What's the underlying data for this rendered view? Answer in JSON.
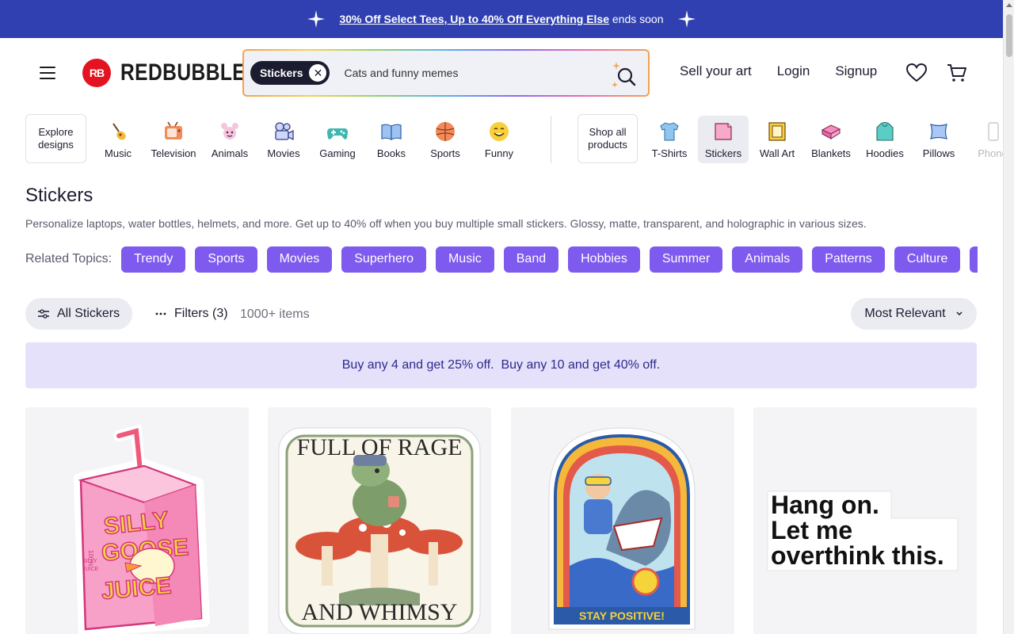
{
  "promo": {
    "link_text": "30% Off Select Tees, Up to 40% Off Everything Else",
    "suffix": "ends soon"
  },
  "header": {
    "logo_mark": "RB",
    "logo_text": "REDBUBBLE",
    "search": {
      "chip_label": "Stickers",
      "placeholder": "Cats and funny memes"
    },
    "links": [
      "Sell your art",
      "Login",
      "Signup"
    ]
  },
  "category_bar": {
    "explore": "Explore designs",
    "design_categories": [
      {
        "label": "Music",
        "icon": "guitar-icon"
      },
      {
        "label": "Television",
        "icon": "tv-icon"
      },
      {
        "label": "Animals",
        "icon": "animal-icon"
      },
      {
        "label": "Movies",
        "icon": "movie-camera-icon"
      },
      {
        "label": "Gaming",
        "icon": "gamepad-icon"
      },
      {
        "label": "Books",
        "icon": "book-icon"
      },
      {
        "label": "Sports",
        "icon": "ball-icon"
      },
      {
        "label": "Funny",
        "icon": "smile-icon"
      }
    ],
    "shop_all": "Shop all products",
    "product_categories": [
      {
        "label": "T-Shirts",
        "icon": "tshirt-icon"
      },
      {
        "label": "Stickers",
        "icon": "sticker-icon",
        "active": true
      },
      {
        "label": "Wall Art",
        "icon": "frame-icon"
      },
      {
        "label": "Blankets",
        "icon": "blanket-icon"
      },
      {
        "label": "Hoodies",
        "icon": "hoodie-icon"
      },
      {
        "label": "Pillows",
        "icon": "pillow-icon"
      },
      {
        "label": "Phone",
        "icon": "phone-icon"
      }
    ]
  },
  "page": {
    "title": "Stickers",
    "description": "Personalize laptops, water bottles, helmets, and more. Get up to 40% off when you buy multiple small stickers. Glossy, matte, transparent, and holographic in various sizes."
  },
  "related": {
    "label": "Related Topics:",
    "topics": [
      "Trendy",
      "Sports",
      "Movies",
      "Superhero",
      "Music",
      "Band",
      "Hobbies",
      "Summer",
      "Animals",
      "Patterns",
      "Culture",
      ""
    ]
  },
  "filters": {
    "all_label": "All Stickers",
    "filters_label": "Filters (3)",
    "count": "1000+ items",
    "sort_label": "Most Relevant"
  },
  "banner": {
    "text": "Buy any 4 and get 25% off.  Buy any 10 and get 40% off."
  },
  "products": [
    {
      "art_text": [
        "SILLY",
        "GOOSE",
        "JUICE",
        "100%",
        "SILLY",
        "JUICE"
      ]
    },
    {
      "art_text": [
        "FULL OF RAGE",
        "AND WHIMSY"
      ]
    },
    {
      "art_text": [
        "STAY POSITIVE!"
      ]
    },
    {
      "art_text": [
        "Hang on.",
        "Let me",
        "overthink this."
      ]
    }
  ],
  "colors": {
    "promo_bg": "#3040b0",
    "topic_pill": "#7e5aee",
    "banner_bg": "#e6e1fb",
    "logo_red": "#e41321"
  }
}
